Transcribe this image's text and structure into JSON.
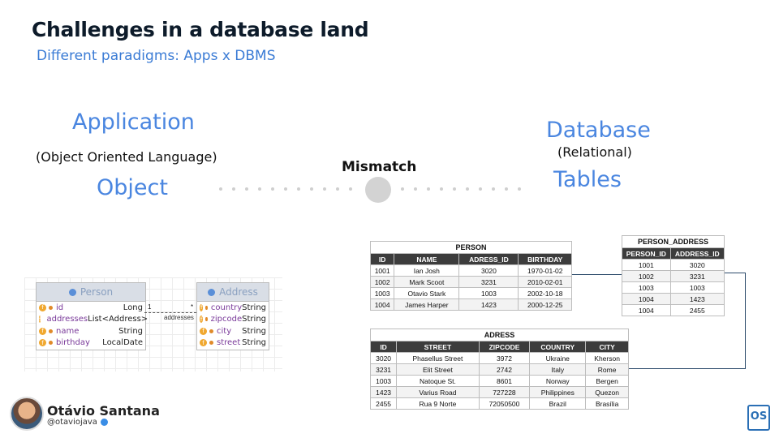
{
  "slide": {
    "title": "Challenges in a database land",
    "subtitle": "Different paradigms: Apps x DBMS"
  },
  "left": {
    "application": "Application",
    "application_sub": "(Object Oriented Language)",
    "object": "Object"
  },
  "center": {
    "mismatch": "Mismatch"
  },
  "right": {
    "database": "Database",
    "database_sub": "(Relational)",
    "tables": "Tables"
  },
  "uml": {
    "person": {
      "name": "Person",
      "fields": [
        {
          "name": "id",
          "type": "Long"
        },
        {
          "name": "addresses",
          "type": "List<Address>"
        },
        {
          "name": "name",
          "type": "String"
        },
        {
          "name": "birthday",
          "type": "LocalDate"
        }
      ]
    },
    "address": {
      "name": "Address",
      "fields": [
        {
          "name": "country",
          "type": "String"
        },
        {
          "name": "zipcode",
          "type": "String"
        },
        {
          "name": "city",
          "type": "String"
        },
        {
          "name": "street",
          "type": "String"
        }
      ]
    },
    "relation_label": "addresses",
    "multiplicity_left": "1",
    "multiplicity_right": "*"
  },
  "tables": {
    "person": {
      "caption": "PERSON",
      "headers": [
        "ID",
        "NAME",
        "ADRESS_ID",
        "BIRTHDAY"
      ],
      "rows": [
        [
          "1001",
          "Ian Josh",
          "3020",
          "1970-01-02"
        ],
        [
          "1002",
          "Mark Scoot",
          "3231",
          "2010-02-01"
        ],
        [
          "1003",
          "Otavio Stark",
          "1003",
          "2002-10-18"
        ],
        [
          "1004",
          "James Harper",
          "1423",
          "2000-12-25"
        ]
      ]
    },
    "person_address": {
      "caption": "PERSON_ADDRESS",
      "headers": [
        "PERSON_ID",
        "ADDRESS_ID"
      ],
      "rows": [
        [
          "1001",
          "3020"
        ],
        [
          "1002",
          "3231"
        ],
        [
          "1003",
          "1003"
        ],
        [
          "1004",
          "1423"
        ],
        [
          "1004",
          "2455"
        ]
      ]
    },
    "adress": {
      "caption": "ADRESS",
      "headers": [
        "ID",
        "STREET",
        "ZIPCODE",
        "COUNTRY",
        "CITY"
      ],
      "rows": [
        [
          "3020",
          "Phasellus Street",
          "3972",
          "Ukraine",
          "Kherson"
        ],
        [
          "3231",
          "Elit Street",
          "2742",
          "Italy",
          "Rome"
        ],
        [
          "1003",
          "Natoque St.",
          "8601",
          "Norway",
          "Bergen"
        ],
        [
          "1423",
          "Varius Road",
          "727228",
          "Philippines",
          "Quezon"
        ],
        [
          "2455",
          "Rua 9 Norte",
          "72050500",
          "Brazil",
          "Brasília"
        ]
      ]
    }
  },
  "footer": {
    "author": "Otávio Santana",
    "handle": "@otaviojava",
    "logo": "OS"
  },
  "colors": {
    "accent_blue": "#4a86e0",
    "title_dark": "#0d1b2a",
    "header_dark": "#3c3c3c"
  }
}
